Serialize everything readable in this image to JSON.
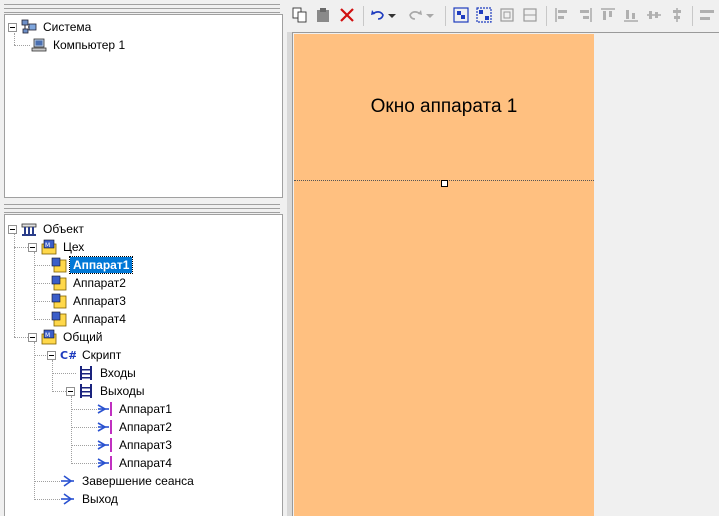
{
  "system_tree": {
    "root": "Система",
    "computer": "Компьютер 1"
  },
  "object_tree": {
    "root": "Объект",
    "workshop": {
      "label": "Цех",
      "items": [
        "Аппарат1",
        "Аппарат2",
        "Аппарат3",
        "Аппарат4"
      ],
      "selected": "Аппарат1"
    },
    "common": {
      "label": "Общий",
      "script": {
        "label": "Скрипт",
        "inputs": "Входы",
        "outputs": {
          "label": "Выходы",
          "items": [
            "Аппарат1",
            "Аппарат2",
            "Аппарат3",
            "Аппарат4"
          ]
        }
      },
      "session_end": "Завершение сеанса",
      "exit": "Выход"
    }
  },
  "toolbar": {
    "buttons": [
      "copy-icon",
      "paste-icon",
      "delete-icon",
      "undo-icon",
      "undo-dropdown-icon",
      "redo-icon",
      "redo-dropdown-icon",
      "group-icon",
      "ungroup-icon",
      "frame-icon",
      "frame-alt-icon",
      "align-left-icon",
      "align-right-icon",
      "align-top-icon",
      "align-bottom-icon",
      "align-center-h-icon",
      "align-center-v-icon",
      "more-icon"
    ]
  },
  "canvas": {
    "window_title": "Окно аппарата 1",
    "window_color": "#ffc080",
    "selection_color": "#0078d7"
  }
}
